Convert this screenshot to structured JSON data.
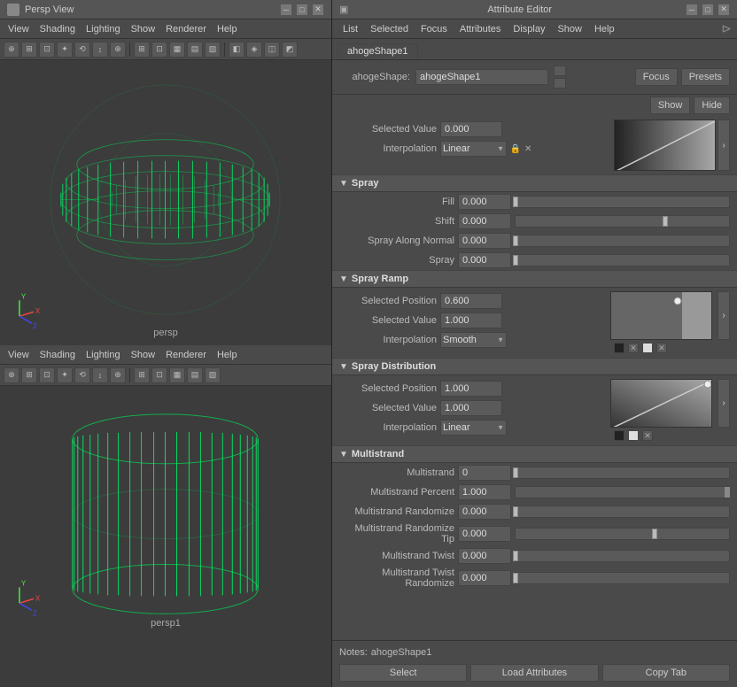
{
  "viewport_title": "Persp View",
  "viewport_menus": [
    "View",
    "Shading",
    "Lighting",
    "Show",
    "Renderer",
    "Help"
  ],
  "viewport_bottom_title": "Persp View",
  "persp_label": "persp",
  "persp1_label": "persp1",
  "attr_editor_title": "Attribute Editor",
  "attr_menus": [
    "List",
    "Selected",
    "Focus",
    "Attributes",
    "Display",
    "Show",
    "Help"
  ],
  "tab_name": "ahogeShape1",
  "shape_label": "ahogeShape:",
  "shape_value": "ahogeShape1",
  "focus_btn": "Focus",
  "presets_btn": "Presets",
  "show_btn": "Show",
  "hide_btn": "Hide",
  "ramp1": {
    "selected_value_label": "Selected Value",
    "selected_value": "0.000",
    "interpolation_label": "Interpolation",
    "interpolation_value": "Linear"
  },
  "spray_section": {
    "title": "Spray",
    "fill_label": "Fill",
    "fill_value": "0.000",
    "fill_slider": 0,
    "shift_label": "Shift",
    "shift_value": "0.000",
    "shift_slider": 70,
    "spray_normal_label": "Spray Along Normal",
    "spray_normal_value": "0.000",
    "spray_normal_slider": 0,
    "spray_label": "Spray",
    "spray_value": "0.000",
    "spray_slider": 0
  },
  "spray_ramp_section": {
    "title": "Spray Ramp",
    "selected_pos_label": "Selected Position",
    "selected_pos_value": "0.600",
    "selected_val_label": "Selected Value",
    "selected_val_value": "1.000",
    "interp_label": "Interpolation",
    "interp_value": "Smooth"
  },
  "spray_dist_section": {
    "title": "Spray Distribution",
    "selected_pos_label": "Selected Position",
    "selected_pos_value": "1.000",
    "selected_val_label": "Selected Value",
    "selected_val_value": "1.000",
    "interp_label": "Interpolation",
    "interp_value": "Linear"
  },
  "multistrand_section": {
    "title": "Multistrand",
    "multistrand_label": "Multistrand",
    "multistrand_value": "0",
    "multistrand_slider": 0,
    "percent_label": "Multistrand Percent",
    "percent_value": "1.000",
    "percent_slider": 100,
    "randomize_label": "Multistrand Randomize",
    "randomize_value": "0.000",
    "randomize_slider": 0,
    "rand_tip_label": "Multistrand Randomize Tip",
    "rand_tip_value": "0.000",
    "rand_tip_slider": 65,
    "twist_label": "Multistrand Twist",
    "twist_value": "0.000",
    "twist_slider": 0,
    "twist_rand_label": "Multistrand Twist Randomize",
    "twist_rand_value": "0.000",
    "twist_rand_slider": 0
  },
  "notes_label": "Notes:",
  "notes_value": "ahogeShape1",
  "select_btn": "Select",
  "load_btn": "Load Attributes",
  "copy_btn": "Copy Tab"
}
